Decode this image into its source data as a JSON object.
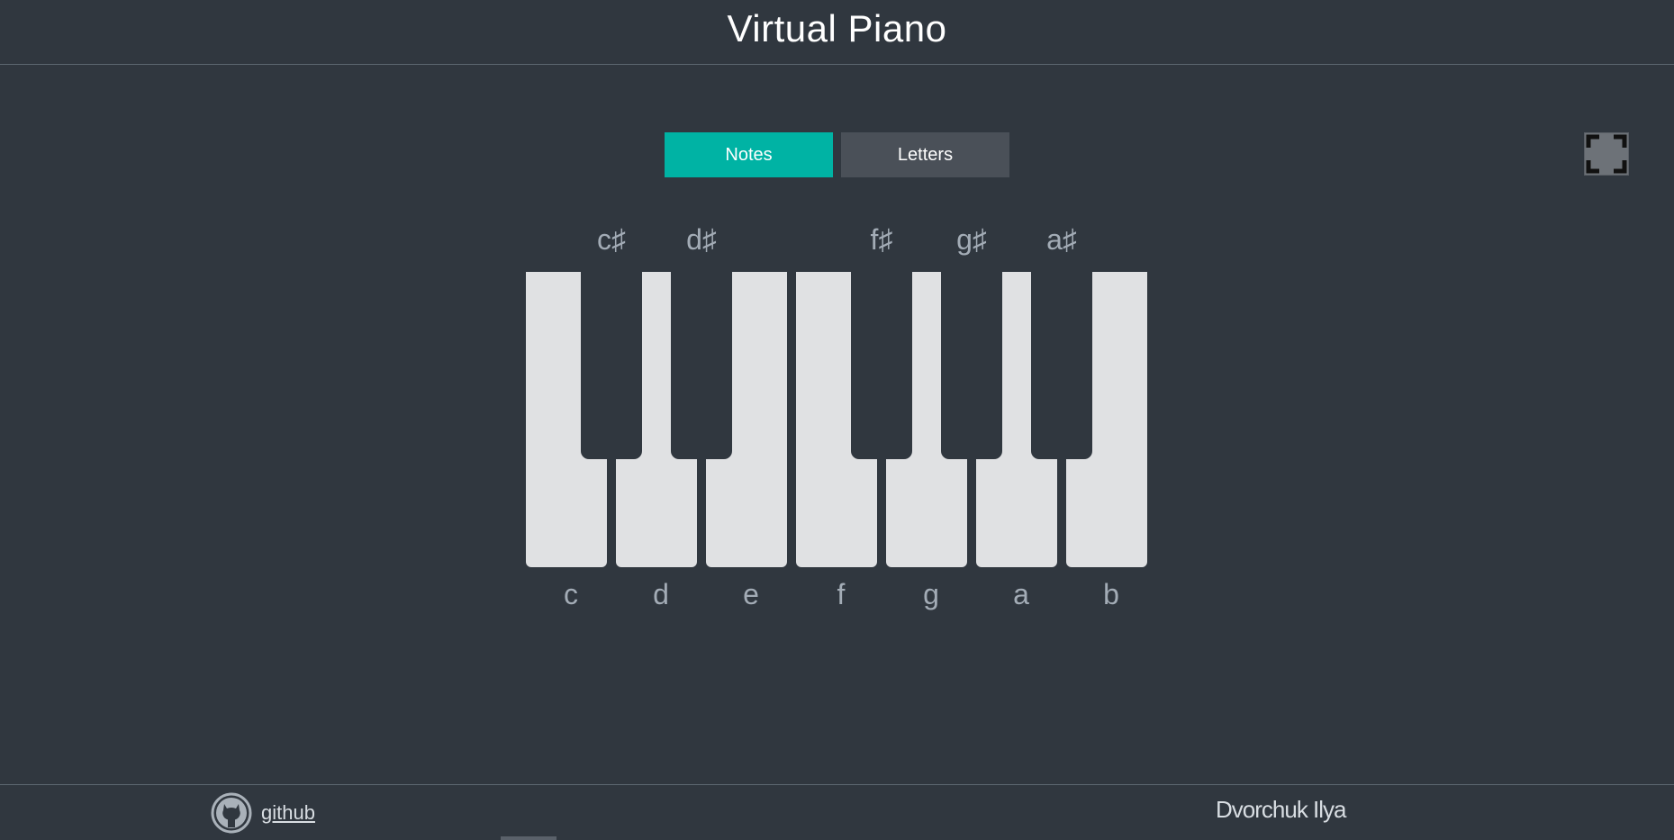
{
  "header": {
    "title": "Virtual Piano"
  },
  "toggle": {
    "notes_label": "Notes",
    "letters_label": "Letters",
    "active": "Notes"
  },
  "fullscreen": {
    "icon": "fullscreen-icon"
  },
  "piano": {
    "white_keys": [
      "c",
      "d",
      "e",
      "f",
      "g",
      "a",
      "b"
    ],
    "black_keys": [
      "c♯",
      "d♯",
      "f♯",
      "g♯",
      "a♯"
    ]
  },
  "footer": {
    "github_label": "github",
    "github_icon": "github-icon",
    "author": "Dvorchuk Ilya"
  },
  "colors": {
    "background": "#30373f",
    "accent": "#00b3a4",
    "key_white": "#e0e1e3"
  }
}
